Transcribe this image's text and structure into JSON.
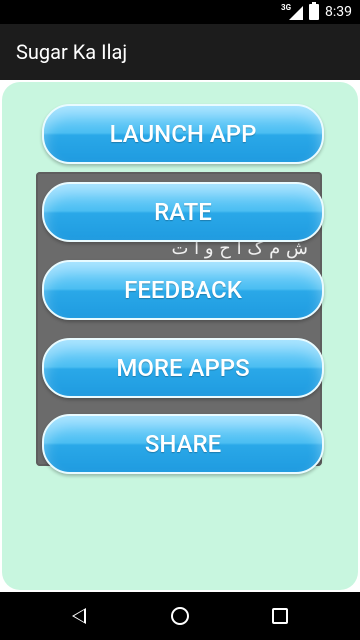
{
  "status": {
    "network": "3G",
    "time": "8:39",
    "icons": [
      "signal-icon",
      "battery-icon"
    ]
  },
  "appbar": {
    "title": "Sugar Ka Ilaj"
  },
  "buttons": {
    "launch": "LAUNCH APP",
    "rate": "RATE",
    "feedback": "FEEDBACK",
    "more": "MORE APPS",
    "share": "SHARE"
  },
  "image": {
    "urdu_text": "ش م ک ا ح و ا ت"
  },
  "colors": {
    "panel_bg": "#c8f6df",
    "button_blue": "#2aa8e8",
    "appbar_bg": "#1c1c1c"
  },
  "nav": {
    "icons": [
      "back-icon",
      "home-icon",
      "recents-icon"
    ]
  }
}
